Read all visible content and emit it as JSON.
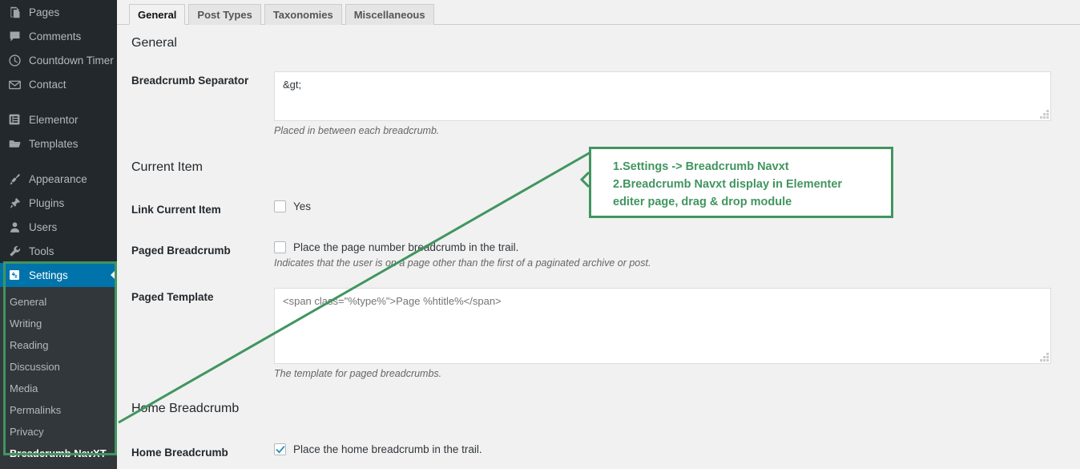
{
  "sidebar": {
    "items": [
      {
        "label": "Pages",
        "icon": "pages-icon"
      },
      {
        "label": "Comments",
        "icon": "comments-icon"
      },
      {
        "label": "Countdown Timer",
        "icon": "clock-icon"
      },
      {
        "label": "Contact",
        "icon": "envelope-icon"
      },
      {
        "label": "Elementor",
        "icon": "elementor-icon"
      },
      {
        "label": "Templates",
        "icon": "folder-icon"
      },
      {
        "label": "Appearance",
        "icon": "paintbrush-icon"
      },
      {
        "label": "Plugins",
        "icon": "plug-icon"
      },
      {
        "label": "Users",
        "icon": "user-icon"
      },
      {
        "label": "Tools",
        "icon": "wrench-icon"
      }
    ],
    "settings": {
      "label": "Settings",
      "icon": "settings-icon"
    },
    "submenu": [
      {
        "label": "General",
        "active": false
      },
      {
        "label": "Writing",
        "active": false
      },
      {
        "label": "Reading",
        "active": false
      },
      {
        "label": "Discussion",
        "active": false
      },
      {
        "label": "Media",
        "active": false
      },
      {
        "label": "Permalinks",
        "active": false
      },
      {
        "label": "Privacy",
        "active": false
      },
      {
        "label": "Breadcrumb NavXT",
        "active": true
      }
    ]
  },
  "tabs": [
    {
      "label": "General"
    },
    {
      "label": "Post Types"
    },
    {
      "label": "Taxonomies"
    },
    {
      "label": "Miscellaneous"
    }
  ],
  "headings": {
    "general": "General",
    "current_item": "Current Item",
    "home_breadcrumb": "Home Breadcrumb"
  },
  "fields": {
    "separator": {
      "label": "Breadcrumb Separator",
      "value": "&gt;",
      "help": "Placed in between each breadcrumb."
    },
    "link_current_item": {
      "label": "Link Current Item",
      "checkbox_text": "Yes",
      "checked": false
    },
    "paged_breadcrumb": {
      "label": "Paged Breadcrumb",
      "checkbox_text": "Place the page number breadcrumb in the trail.",
      "checked": false,
      "help": "Indicates that the user is on a page other than the first of a paginated archive or post."
    },
    "paged_template": {
      "label": "Paged Template",
      "placeholder": "<span class=\"%type%\">Page %htitle%</span>",
      "value": "",
      "help": "The template for paged breadcrumbs."
    },
    "home_breadcrumb": {
      "label": "Home Breadcrumb",
      "checkbox_text": "Place the home breadcrumb in the trail.",
      "checked": true
    }
  },
  "annotation": {
    "line1": "1.Settings -> Breadcrumb Navxt",
    "line2": "2.Breadcrumb Navxt display in Elementer",
    "line3": "editer page, drag & drop module",
    "color": "#41955f"
  },
  "colors": {
    "sidebar_bg": "#23282d",
    "submenu_bg": "#32373c",
    "accent_blue": "#0073aa",
    "page_bg": "#f1f1f1",
    "annotation_green": "#41955f"
  }
}
